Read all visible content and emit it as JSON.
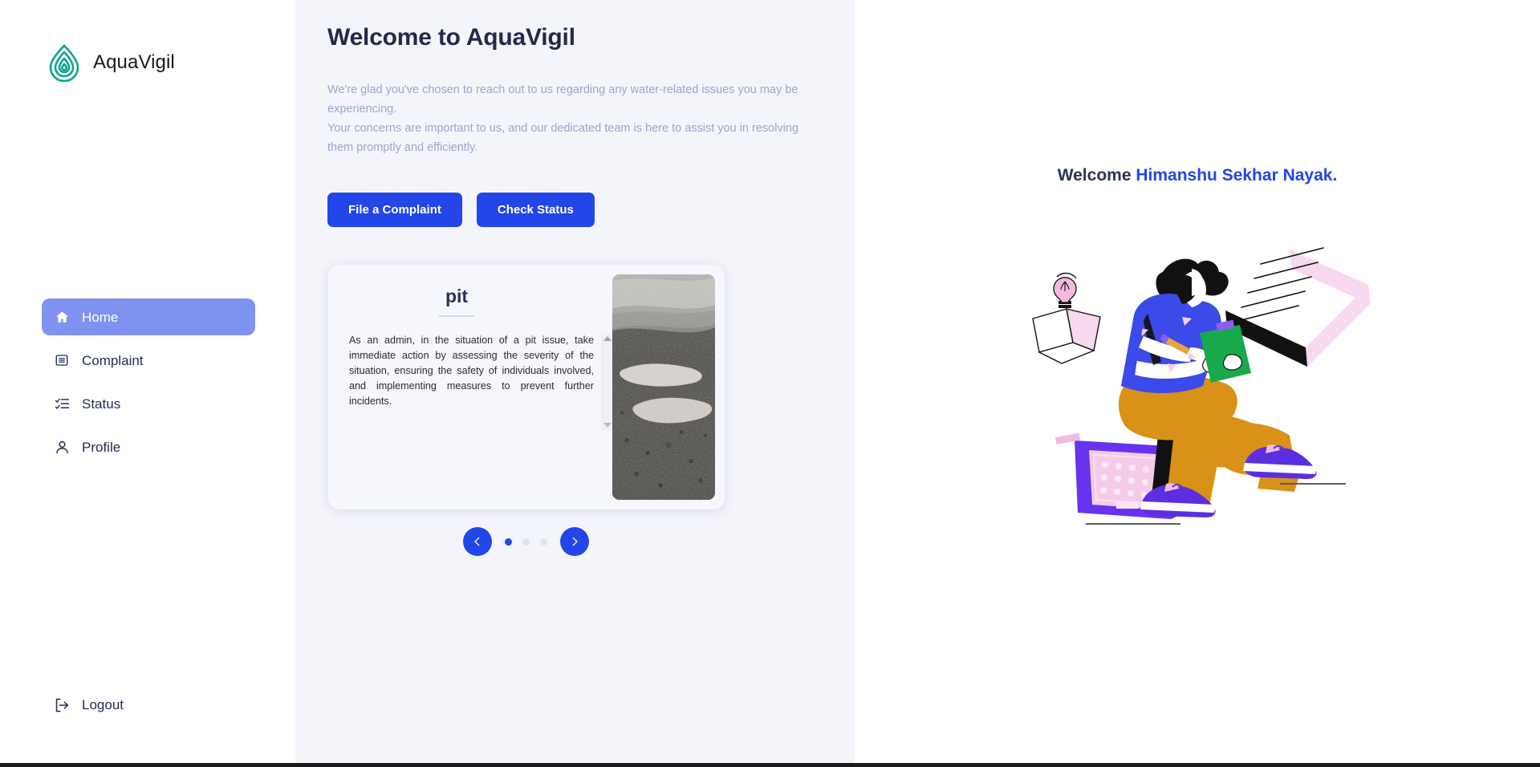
{
  "brand": {
    "name": "AquaVigil",
    "logo_icon": "water-droplet-icon",
    "logo_color": "#09a58f"
  },
  "sidebar": {
    "items": [
      {
        "label": "Home",
        "icon": "home-icon",
        "active": true
      },
      {
        "label": "Complaint",
        "icon": "document-icon",
        "active": false
      },
      {
        "label": "Status",
        "icon": "checklist-icon",
        "active": false
      },
      {
        "label": "Profile",
        "icon": "user-icon",
        "active": false
      }
    ],
    "logout": {
      "label": "Logout",
      "icon": "sign-out-icon"
    },
    "active_bg": "#7f92ef",
    "text_color": "#1f2a52"
  },
  "main": {
    "title": "Welcome to AquaVigil",
    "intro_line_1": "We're glad you've chosen to reach out to us regarding any water-related issues you may be experiencing.",
    "intro_line_2": "Your concerns are important to us, and our dedicated team is here to assist you in resolving them promptly and efficiently.",
    "buttons": {
      "file_complaint": "File a Complaint",
      "check_status": "Check Status"
    },
    "accent_color": "#2346e8",
    "panel_bg": "#f4f5fb"
  },
  "card": {
    "title": "pit",
    "body": "As an admin, in the situation of a pit issue, take immediate action by assessing the severity of the situation, ensuring the safety of individuals involved, and implementing measures to prevent further incidents.",
    "image_alt": "pothole-photo",
    "scrollbar": {
      "up_icon": "scroll-up-arrow-icon",
      "down_icon": "scroll-down-arrow-icon"
    }
  },
  "carousel": {
    "prev_icon": "chevron-left-icon",
    "next_icon": "chevron-right-icon",
    "dots": [
      {
        "active": true
      },
      {
        "active": false
      },
      {
        "active": false
      }
    ]
  },
  "right_panel": {
    "welcome_prefix": "Welcome ",
    "user_name": "Himanshu Sekhar Nayak.",
    "illustration": "person-writing-on-clipboard-illustration",
    "illustration_colors": {
      "shirt": "#3b4ae8",
      "pants": "#d99118",
      "shoes": "#5b2fe0",
      "clipboard": "#19a84a",
      "box": "#6733ef",
      "pink": "#f6cbe8",
      "hair": "#111111"
    }
  }
}
